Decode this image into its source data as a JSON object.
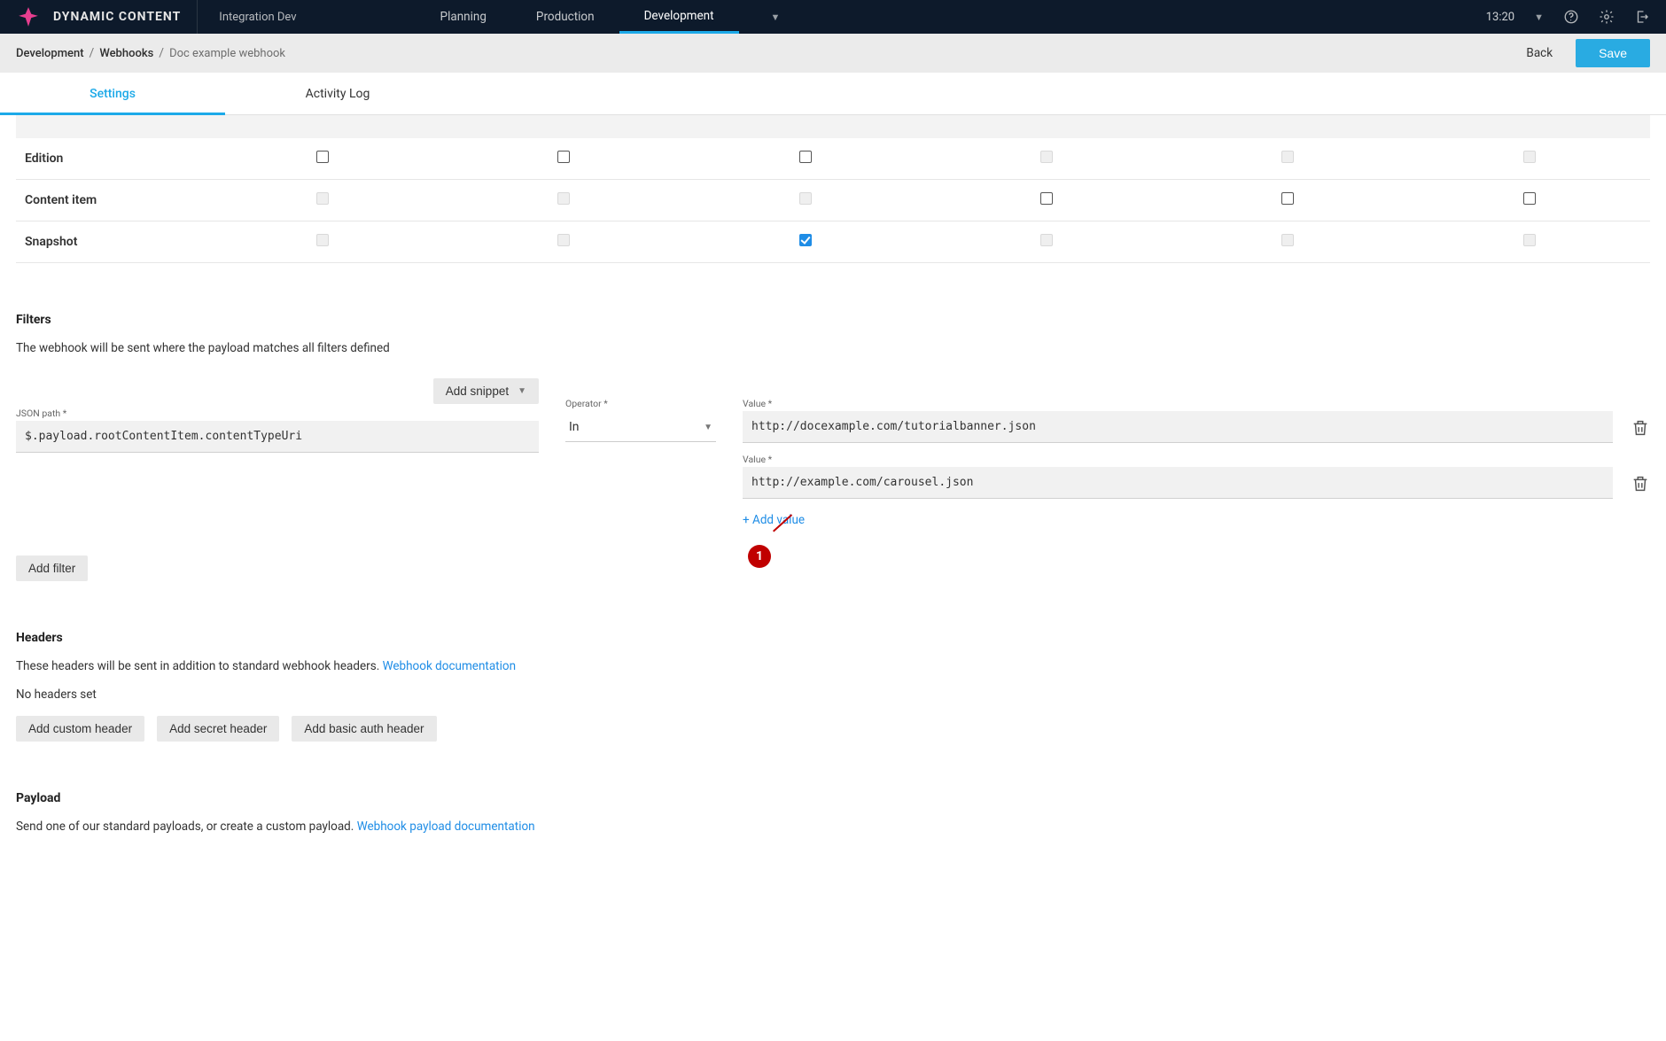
{
  "brand": "DYNAMIC CONTENT",
  "hub": "Integration Dev",
  "nav": {
    "items": [
      "Planning",
      "Production",
      "Development"
    ],
    "active": "Development"
  },
  "top": {
    "time": "13:20"
  },
  "breadcrumb": {
    "seg1": "Development",
    "seg2": "Webhooks",
    "seg3": "Doc example webhook",
    "back": "Back",
    "save": "Save"
  },
  "subtabs": {
    "settings": "Settings",
    "activity": "Activity Log"
  },
  "trigger_rows": {
    "edition": "Edition",
    "content_item": "Content item",
    "snapshot": "Snapshot"
  },
  "filters": {
    "title": "Filters",
    "desc": "The webhook will be sent where the payload matches all filters defined",
    "add_snippet": "Add snippet",
    "json_label": "JSON path *",
    "json_value": "$.payload.rootContentItem.contentTypeUri",
    "operator_label": "Operator *",
    "operator_value": "In",
    "value_label": "Value *",
    "value1": "http://docexample.com/tutorialbanner.json",
    "value2": "http://example.com/carousel.json",
    "add_value": "+ Add value",
    "add_filter": "Add filter"
  },
  "annotation": {
    "n": "1"
  },
  "headers": {
    "title": "Headers",
    "desc": "These headers will be sent in addition to standard webhook headers.  ",
    "doc_link": "Webhook documentation",
    "none": "No headers set",
    "add_custom": "Add custom header",
    "add_secret": "Add secret header",
    "add_basic": "Add basic auth header"
  },
  "payload": {
    "title": "Payload",
    "desc": "Send one of our standard payloads, or create a custom payload.  ",
    "doc_link": "Webhook payload documentation"
  }
}
